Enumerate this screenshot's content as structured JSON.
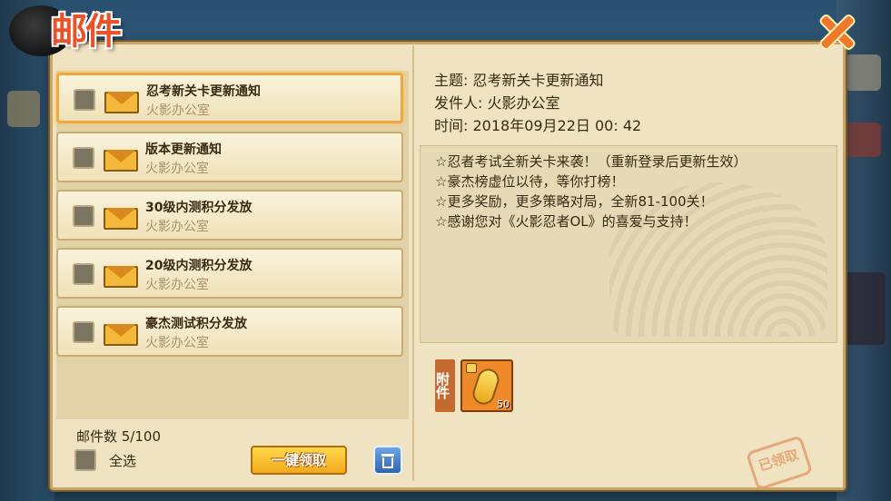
{
  "title": "邮件",
  "mails": [
    {
      "title": "忍考新关卡更新通知",
      "sender": "火影办公室",
      "selected": true
    },
    {
      "title": "版本更新通知",
      "sender": "火影办公室",
      "selected": false
    },
    {
      "title": "30级内测积分发放",
      "sender": "火影办公室",
      "selected": false
    },
    {
      "title": "20级内测积分发放",
      "sender": "火影办公室",
      "selected": false
    },
    {
      "title": "豪杰测试积分发放",
      "sender": "火影办公室",
      "selected": false
    }
  ],
  "footer": {
    "count": "邮件数 5/100",
    "select_all": "全选",
    "claim_all": "一键领取"
  },
  "detail": {
    "subject": "主题: 忍考新关卡更新通知",
    "sender": "发件人: 火影办公室",
    "time": "时间: 2018年09月22日  00: 42",
    "lines": [
      "☆忍者考试全新关卡来袭！（重新登录后更新生效）",
      "☆豪杰榜虚位以待，等你打榜！",
      "☆更多奖励，更多策略对局，全新81-100关！",
      "☆感谢您对《火影忍者OL》的喜爱与支持！"
    ],
    "attachment_label": "附件",
    "attachment_qty": "50",
    "claimed_stamp": "已领取"
  },
  "colors": {
    "title": "#e9532a",
    "panel": "#efe3c1",
    "accent": "#f2a640",
    "claim_button": "#f2a91c",
    "trash_button": "#2f64b2"
  }
}
